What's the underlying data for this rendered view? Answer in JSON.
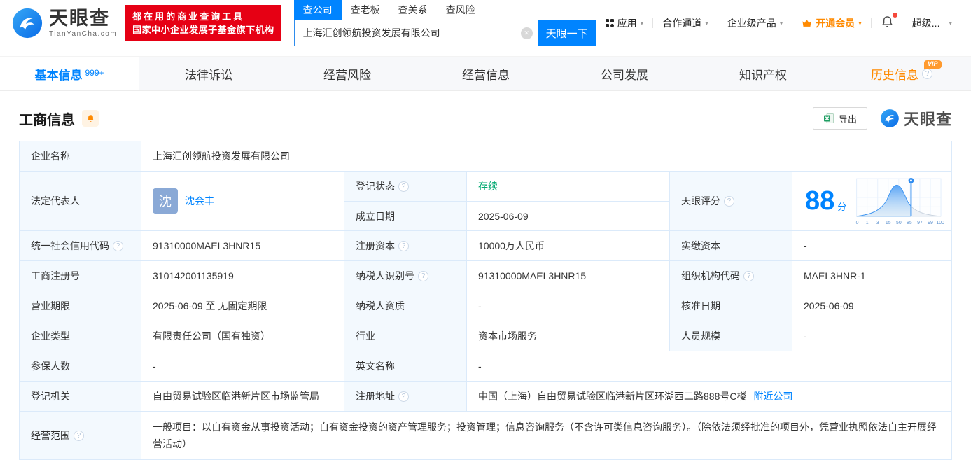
{
  "icons": {
    "help": "?",
    "caret_down": "▾",
    "clear": "✕"
  },
  "header": {
    "brand": "天眼查",
    "brand_domain": "TianYanCha.com",
    "slogan_line1": "都在用的商业查询工具",
    "slogan_line2": "国家中小企业发展子基金旗下机构",
    "search_tabs": [
      "查公司",
      "查老板",
      "查关系",
      "查风险"
    ],
    "search_value": "上海汇创领航投资发展有限公司",
    "search_button": "天眼一下",
    "nav_app": "应用",
    "nav_partner": "合作通道",
    "nav_enterprise": "企业级产品",
    "nav_vip": "开通会员",
    "nav_super": "超级..."
  },
  "tabs": {
    "basic": "基本信息",
    "basic_badge": "999+",
    "legal": "法律诉讼",
    "risk": "经营风险",
    "operation": "经营信息",
    "development": "公司发展",
    "ip": "知识产权",
    "history": "历史信息",
    "history_vip": "VIP"
  },
  "section": {
    "title": "工商信息",
    "export": "导出",
    "watermark_brand": "天眼查"
  },
  "fields": {
    "company_name": {
      "label": "企业名称",
      "value": "上海汇创领航投资发展有限公司"
    },
    "legal_rep": {
      "label": "法定代表人",
      "avatar": "沈",
      "name": "沈会丰"
    },
    "reg_status": {
      "label": "登记状态",
      "value": "存续"
    },
    "establish_date": {
      "label": "成立日期",
      "value": "2025-06-09"
    },
    "score": {
      "label": "天眼评分",
      "value": "88",
      "unit": "分"
    },
    "credit_code": {
      "label": "统一社会信用代码",
      "value": "91310000MAEL3HNR15"
    },
    "reg_capital": {
      "label": "注册资本",
      "value": "10000万人民币"
    },
    "paid_capital": {
      "label": "实缴资本",
      "value": "-"
    },
    "reg_number": {
      "label": "工商注册号",
      "value": "310142001135919"
    },
    "taxpayer_id": {
      "label": "纳税人识别号",
      "value": "91310000MAEL3HNR15"
    },
    "org_code": {
      "label": "组织机构代码",
      "value": "MAEL3HNR-1"
    },
    "business_term": {
      "label": "营业期限",
      "value": "2025-06-09 至 无固定期限"
    },
    "taxpayer_quality": {
      "label": "纳税人资质",
      "value": "-"
    },
    "approval_date": {
      "label": "核准日期",
      "value": "2025-06-09"
    },
    "company_type": {
      "label": "企业类型",
      "value": "有限责任公司（国有独资）"
    },
    "industry": {
      "label": "行业",
      "value": "资本市场服务"
    },
    "staff_size": {
      "label": "人员规模",
      "value": "-"
    },
    "insured_count": {
      "label": "参保人数",
      "value": "-"
    },
    "english_name": {
      "label": "英文名称",
      "value": "-"
    },
    "reg_authority": {
      "label": "登记机关",
      "value": "自由贸易试验区临港新片区市场监管局"
    },
    "reg_address": {
      "label": "注册地址",
      "value": "中国（上海）自由贸易试验区临港新片区环湖西二路888号C楼",
      "link": "附近公司"
    },
    "business_scope": {
      "label": "经营范围",
      "value": "一般项目：以自有资金从事投资活动；自有资金投资的资产管理服务；投资管理；信息咨询服务（不含许可类信息咨询服务）。（除依法须经批准的项目外，凭营业执照依法自主开展经营活动）"
    }
  },
  "score_chart": {
    "type": "area",
    "score": 88,
    "axis_ticks": [
      "0",
      "1",
      "3",
      "15",
      "50",
      "85",
      "97",
      "99",
      "100"
    ]
  }
}
